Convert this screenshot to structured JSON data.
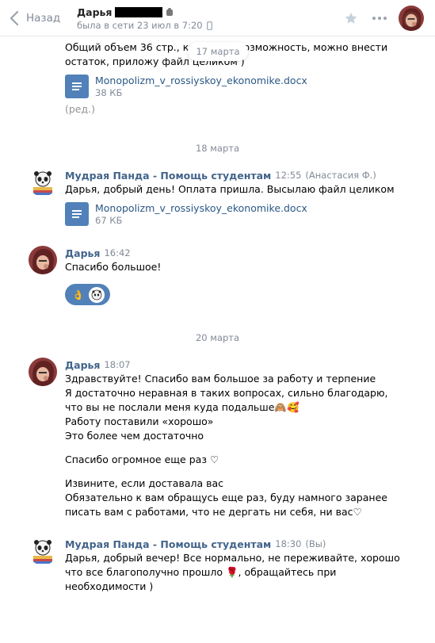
{
  "header": {
    "back_label": "Назад",
    "peer_name": "Дарья",
    "peer_status": "была в сети 23 июл в 7:20"
  },
  "dates": {
    "floating": "17 марта",
    "d18": "18 марта",
    "d20": "20 марта"
  },
  "msg0": {
    "line1": "Общий объем 36 стр., как будет возможность, можно внести",
    "line2": "остаток, приложу файл целиком )",
    "doc_name": "Monopolizm_v_rossiyskoy_ekonomike.docx",
    "doc_size": "38 КБ",
    "edited": "(ред.)"
  },
  "msg1": {
    "author": "Мудрая Панда - Помощь студентам",
    "time": "12:55",
    "sender_note": "(Анастасия Ф.)",
    "text": "Дарья, добрый день! Оплата пришла. Высылаю файл целиком",
    "doc_name": "Monopolizm_v_rossiyskoy_ekonomike.docx",
    "doc_size": "67 КБ"
  },
  "msg2": {
    "author": "Дарья",
    "time": "16:42",
    "text": "Спасибо большое!",
    "reactions": [
      "👌",
      "panda-sticker"
    ]
  },
  "msg3": {
    "author": "Дарья",
    "time": "18:07",
    "lines": [
      "Здравствуйте! Спасибо вам большое за работу и терпение",
      "Я достаточно неравная в таких вопросах, сильно благодарю,",
      "что вы не послали меня куда подальше🙈🥰",
      "Работу поставили «хорошо»",
      "Это более чем достаточно",
      "Спасибо огромное еще раз ♡",
      "Извините, если доставала вас",
      "Обязательно к вам обращусь еще раз, буду намного заранее",
      "писать вам с работами, что не дергать ни себя, ни вас♡"
    ]
  },
  "msg4": {
    "author": "Мудрая Панда - Помощь студентам",
    "time": "18:30",
    "sender_note": "(Вы)",
    "lines": [
      "Дарья, добрый вечер! Все нормально, не переживайте, хорошо",
      "что все благополучно прошло 🌹, обращайтесь при",
      "необходимости )"
    ]
  },
  "colors": {
    "link": "#2a5885",
    "author": "#42648b",
    "muted": "#828a99",
    "accent": "#5181b8"
  }
}
